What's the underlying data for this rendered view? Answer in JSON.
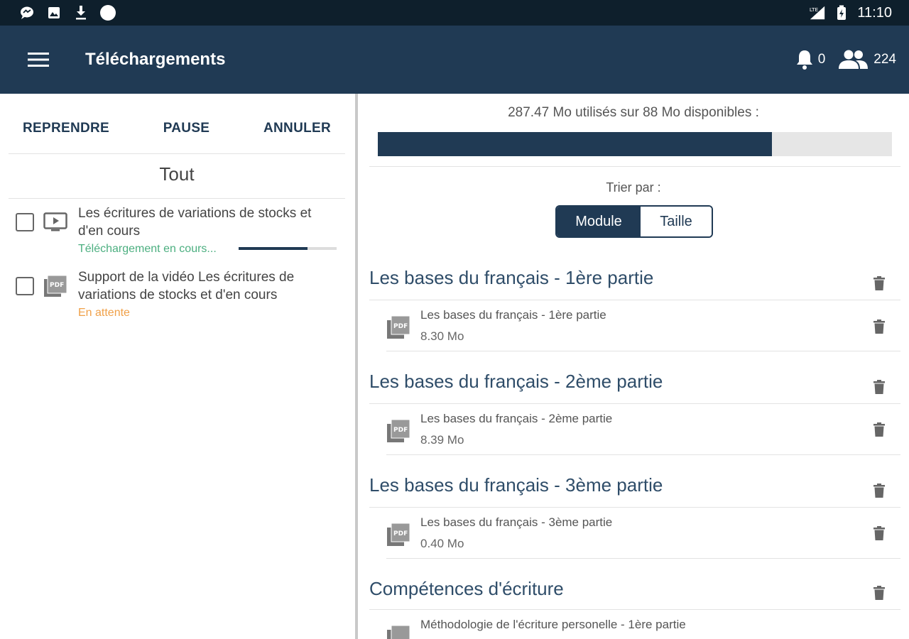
{
  "status_bar": {
    "time": "11:10",
    "network": "LTE",
    "icons": [
      "messenger-icon",
      "image-icon",
      "download-icon",
      "circle-icon"
    ]
  },
  "app_bar": {
    "title": "Téléchargements",
    "notifications_count": "0",
    "users_count": "224"
  },
  "left": {
    "actions": {
      "resume": "REPRENDRE",
      "pause": "PAUSE",
      "cancel": "ANNULER"
    },
    "filter": "Tout",
    "downloads": [
      {
        "title_line1": "Les écritures de variations de stocks et",
        "title_line2": "d'en cours",
        "status": "Téléchargement en cours...",
        "progress": 0.7,
        "type": "video-icon"
      },
      {
        "title_line1": "Support de la vidéo Les écritures de",
        "title_line2": "variations de stocks et d'en cours",
        "status": "En attente",
        "type": "pdf-icon"
      }
    ]
  },
  "right": {
    "storage_text": "287.47 Mo utilisés sur 88 Mo disponibles :",
    "storage_fraction": 0.766,
    "sort_label": "Trier par :",
    "sort_options": {
      "module": "Module",
      "size": "Taille"
    },
    "modules": [
      {
        "title": "Les bases du français - 1ère partie",
        "file_name": "Les bases du français - 1ère partie",
        "file_size": "8.30 Mo"
      },
      {
        "title": "Les bases du français - 2ème partie",
        "file_name": "Les bases du français - 2ème partie",
        "file_size": "8.39 Mo"
      },
      {
        "title": "Les bases du français - 3ème partie",
        "file_name": "Les bases du français - 3ème partie",
        "file_size": "0.40 Mo"
      },
      {
        "title": "Compétences d'écriture",
        "file_name": "Méthodologie de l'écriture personelle - 1ère partie",
        "file_size": ""
      }
    ]
  },
  "colors": {
    "primary": "#203a54",
    "status_bar": "#0e1f2c",
    "downloading": "#4caf80",
    "waiting": "#f0a048"
  }
}
